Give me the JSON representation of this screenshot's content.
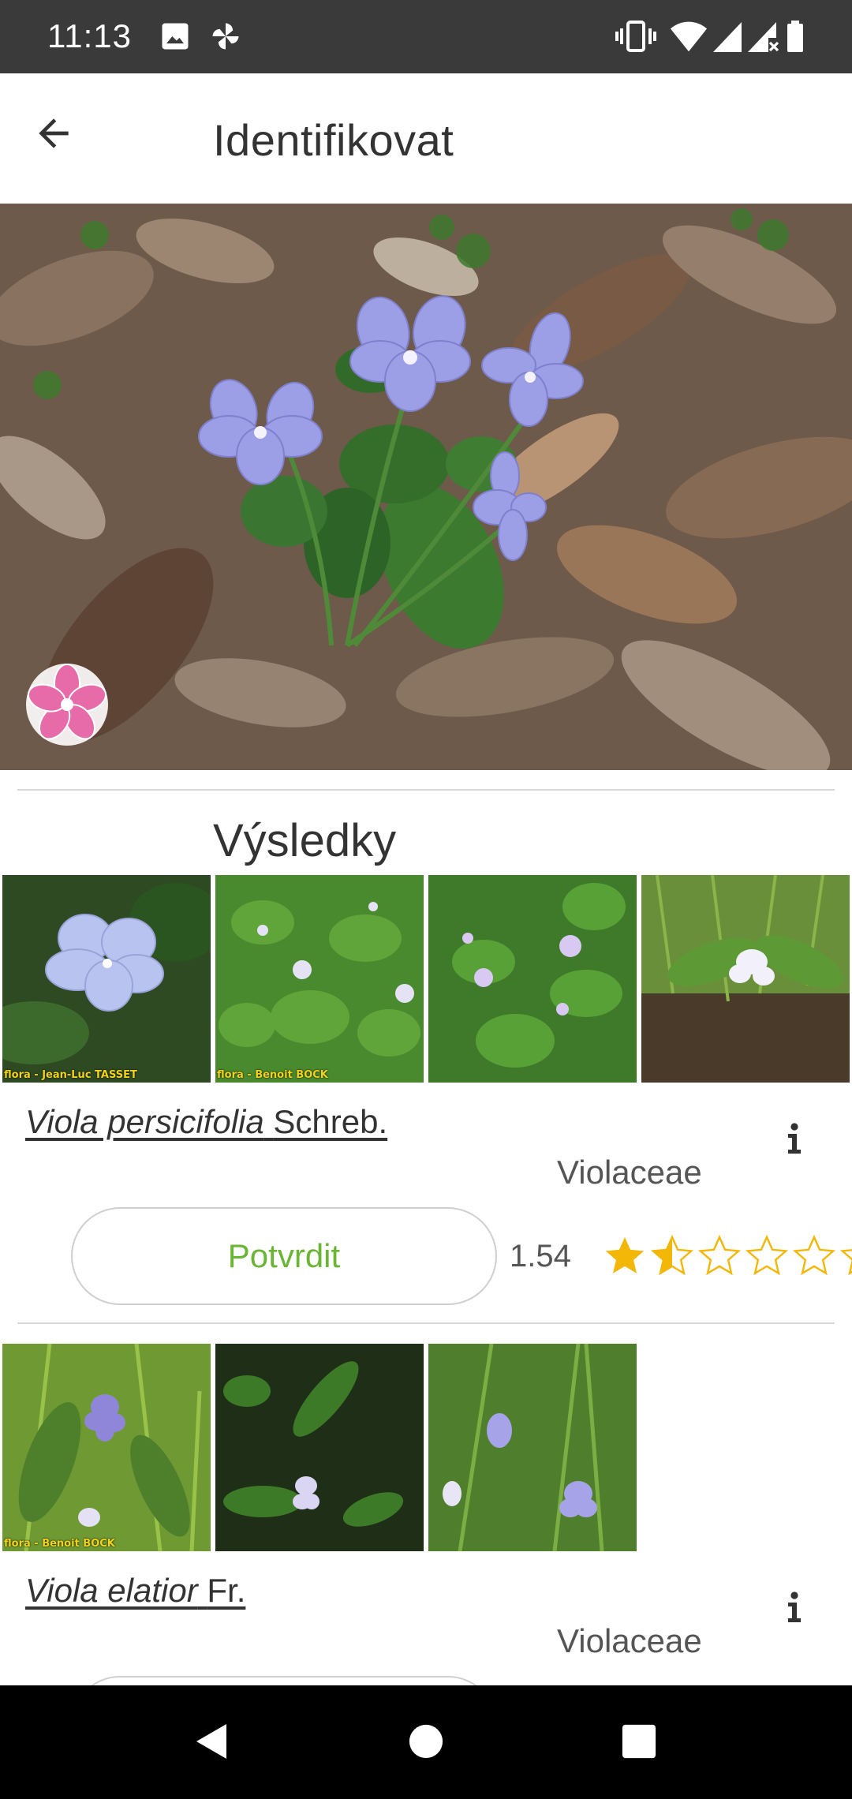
{
  "status_bar": {
    "time": "11:13",
    "left_icons": [
      "image-icon",
      "pinwheel-icon"
    ],
    "right_icons": [
      "vibrate-icon",
      "wifi-icon",
      "signal-icon",
      "signal-no-data-icon",
      "battery-icon"
    ]
  },
  "app_bar": {
    "back_icon": "arrow-left-icon",
    "title": "Identifikovat"
  },
  "results": {
    "heading": "Výsledky",
    "items": [
      {
        "genus": "Viola persicifolia",
        "author": "Schreb.",
        "family": "Violaceae",
        "confirm_label": "Potvrdit",
        "score": "1.54",
        "rating": 1.5,
        "max_rating": 6,
        "thumb_credits": [
          "flora - Jean-Luc TASSET",
          "flora - Benoit BOCK",
          "",
          ""
        ]
      },
      {
        "genus": "Viola elatior",
        "author": "Fr.",
        "family": "Violaceae",
        "thumb_credits": [
          "flora - Benoit BOCK",
          "",
          ""
        ]
      }
    ]
  },
  "colors": {
    "accent_green": "#6bb534",
    "star_gold": "#f2b707",
    "status_bar_bg": "#3a3a3a"
  },
  "nav_bar": {
    "buttons": [
      "back-triangle-icon",
      "home-circle-icon",
      "recents-square-icon"
    ]
  }
}
